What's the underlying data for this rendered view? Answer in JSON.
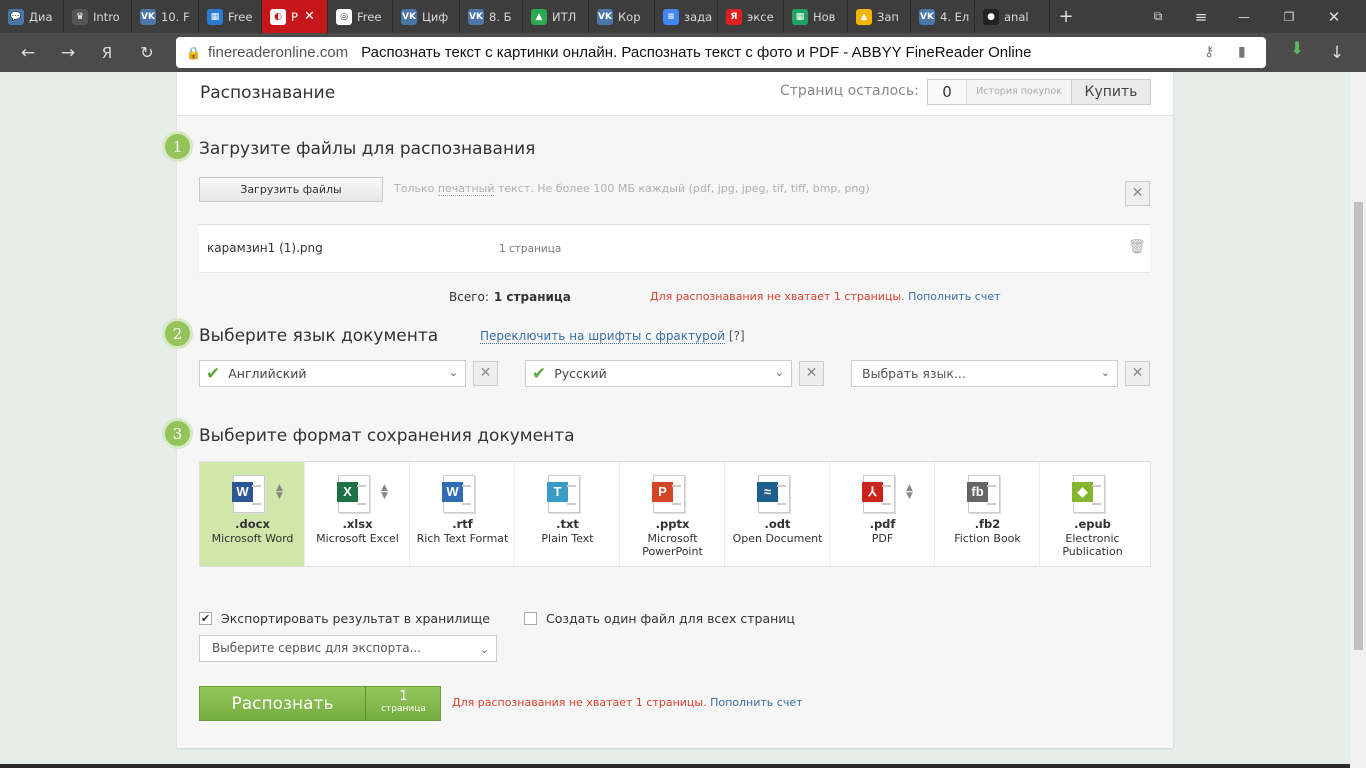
{
  "tabs": [
    {
      "label": "Диа",
      "icon": "chat-icon",
      "color": "#4a76a8",
      "glyph": "💬"
    },
    {
      "label": "Intro",
      "icon": "crown-icon",
      "color": "#555555",
      "glyph": "♛"
    },
    {
      "label": "10. F",
      "icon": "vk-icon",
      "color": "#4a76a8",
      "glyph": "VK"
    },
    {
      "label": "Free",
      "icon": "grid-icon",
      "color": "#2b7bd1",
      "glyph": "▦"
    },
    {
      "label": "Р",
      "icon": "abbyy-icon",
      "color": "#ffffff",
      "glyph": "◐",
      "active": true
    },
    {
      "label": "Free",
      "icon": "shield-icon",
      "color": "#ffffff",
      "glyph": "◎"
    },
    {
      "label": "Циф",
      "icon": "vk-icon",
      "color": "#4a76a8",
      "glyph": "VK"
    },
    {
      "label": "8. Б",
      "icon": "vk-icon",
      "color": "#4a76a8",
      "glyph": "VK"
    },
    {
      "label": "ИТЛ",
      "icon": "drive-icon",
      "color": "#2da94f",
      "glyph": "▲"
    },
    {
      "label": "Кор",
      "icon": "vk-icon",
      "color": "#4a76a8",
      "glyph": "VK"
    },
    {
      "label": "зада",
      "icon": "docs-icon",
      "color": "#4285f4",
      "glyph": "≡"
    },
    {
      "label": "эксе",
      "icon": "yandex-icon",
      "color": "#e02020",
      "glyph": "Я"
    },
    {
      "label": "Нов",
      "icon": "sheets-icon",
      "color": "#1fa463",
      "glyph": "▦"
    },
    {
      "label": "Зап",
      "icon": "chart-icon",
      "color": "#f4b400",
      "glyph": "▲"
    },
    {
      "label": "4. Ел",
      "icon": "vk-icon",
      "color": "#4a76a8",
      "glyph": "VK"
    },
    {
      "label": "anal",
      "icon": "github-icon",
      "color": "#222222",
      "glyph": "●"
    }
  ],
  "address": {
    "domain": "finereaderonline.com",
    "title": "Распознать текст с картинки онлайн. Распознать текст с фото и PDF - ABBYY FineReader Online"
  },
  "header": {
    "title": "Распознавание",
    "pages_left_label": "Страниц осталось:",
    "pages_left_value": "0",
    "history_label": "История покупок",
    "buy_label": "Купить"
  },
  "step1": {
    "number": "1",
    "title": "Загрузите файлы для распознавания",
    "upload_button": "Загрузить файлы",
    "hint_prefix": "Только ",
    "hint_link": "печатный",
    "hint_suffix": " текст. Не более 100 МБ каждый (pdf, jpg, jpeg, tif, tiff, bmp, png)",
    "file_name": "карамзин1 (1).png",
    "file_pages": "1 страница",
    "total_label": "Всего:",
    "total_value": "1 страница",
    "warning": "Для распознавания не хватает 1 страницы.",
    "topup_link": "Пополнить счет"
  },
  "step2": {
    "number": "2",
    "title": "Выберите язык документа",
    "fraktur_link": "Переключить на шрифты с фрактурой",
    "fraktur_help": "[?]",
    "languages": [
      "Английский",
      "Русский"
    ],
    "placeholder": "Выбрать язык..."
  },
  "step3": {
    "number": "3",
    "title": "Выберите формат сохранения документа",
    "formats": [
      {
        "ext": ".docx",
        "desc": "Microsoft Word",
        "badge": "W",
        "color": "#2b5797",
        "selected": true,
        "arrows": true
      },
      {
        "ext": ".xlsx",
        "desc": "Microsoft Excel",
        "badge": "X",
        "color": "#1e7145",
        "arrows": true
      },
      {
        "ext": ".rtf",
        "desc": "Rich Text Format",
        "badge": "W",
        "color": "#2e6db4"
      },
      {
        "ext": ".txt",
        "desc": "Plain Text",
        "badge": "T",
        "color": "#3a9bc7"
      },
      {
        "ext": ".pptx",
        "desc": "Microsoft PowerPoint",
        "badge": "P",
        "color": "#d24726"
      },
      {
        "ext": ".odt",
        "desc": "Open Document",
        "badge": "≈",
        "color": "#1f5f8b"
      },
      {
        "ext": ".pdf",
        "desc": "PDF",
        "badge": "⅄",
        "color": "#c9231c",
        "arrows": true
      },
      {
        "ext": ".fb2",
        "desc": "Fiction Book",
        "badge": "fb",
        "color": "#666666"
      },
      {
        "ext": ".epub",
        "desc": "Electronic Publication",
        "badge": "◆",
        "color": "#84b52c"
      }
    ]
  },
  "options": {
    "export_storage": "Экспортировать результат в хранилище",
    "export_checked": true,
    "single_file": "Создать один файл для всех страниц",
    "single_checked": false,
    "export_placeholder": "Выберите сервис для экспорта..."
  },
  "recognize": {
    "label": "Распознать",
    "pages_num": "1",
    "pages_word": "страница",
    "warning": "Для распознавания не хватает 1 страницы.",
    "topup_link": "Пополнить счет"
  }
}
